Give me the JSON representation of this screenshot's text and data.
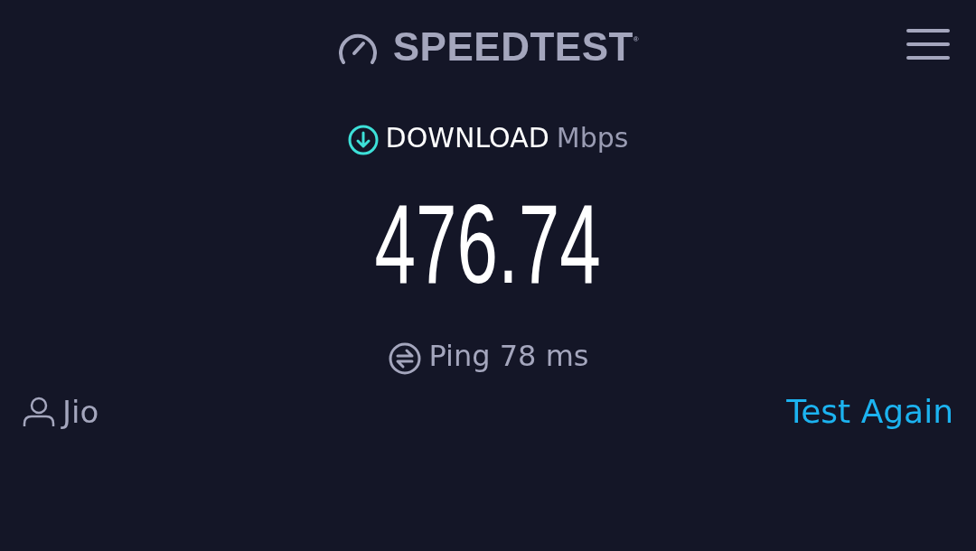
{
  "header": {
    "logo": "SPEEDTEST$^{®}$"
  },
  "result": {
    "label": "DOWNLOAD",
    "unit": "Mbps",
    "value": "476.74"
  },
  "ping": {
    "label": "Ping 78 ms"
  },
  "footer": {
    "provider": "Jio",
    "action": "Test Again"
  }
}
